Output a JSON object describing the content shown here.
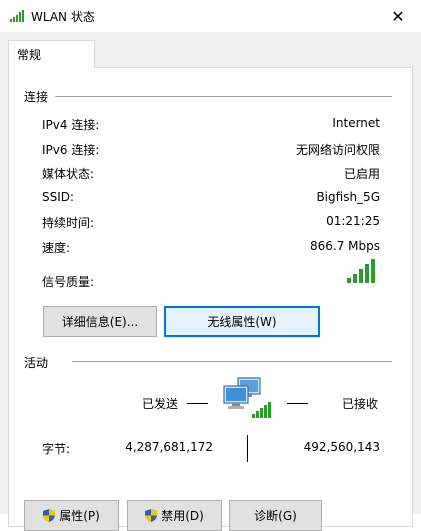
{
  "window": {
    "title": "WLAN 状态",
    "close_glyph": "✕"
  },
  "tab": {
    "label": "常规"
  },
  "connection": {
    "section_label": "连接",
    "rows": [
      {
        "label": "IPv4 连接:",
        "value": "Internet"
      },
      {
        "label": "IPv6 连接:",
        "value": "无网络访问权限"
      },
      {
        "label": "媒体状态:",
        "value": "已启用"
      },
      {
        "label": "SSID:",
        "value": "Bigfish_5G"
      },
      {
        "label": "持续时间:",
        "value": "01:21:25"
      },
      {
        "label": "速度:",
        "value": "866.7 Mbps"
      }
    ],
    "signal_label": "信号质量:",
    "signal_bars": 5,
    "signal_bars_max": 5
  },
  "buttons": {
    "details": "详细信息(E)...",
    "wireless_props": "无线属性(W)"
  },
  "activity": {
    "section_label": "活动",
    "sent_label": "已发送",
    "received_label": "已接收",
    "bytes_label": "字节:",
    "bytes_sent": "4,287,681,172",
    "bytes_received": "492,560,143"
  },
  "bottom_buttons": {
    "properties": "属性(P)",
    "disable": "禁用(D)",
    "diagnose": "诊断(G)"
  },
  "colors": {
    "signal_green": "#2e9a2e",
    "focus_blue": "#0078d7",
    "shield_blue": "#2b5fb4",
    "shield_yellow": "#f2c811"
  },
  "icons": {
    "title": "wifi-signal-icon",
    "network": "network-computers-icon",
    "shield": "uac-shield-icon"
  }
}
